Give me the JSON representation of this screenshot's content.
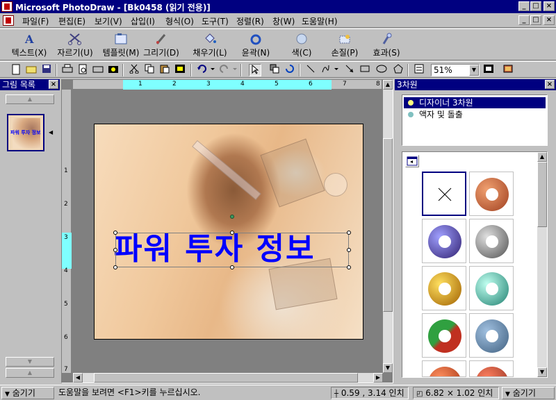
{
  "window": {
    "title": "Microsoft PhotoDraw - [Bk0458 (읽기 전용)]",
    "caption_buttons": [
      "_",
      "□",
      "×"
    ]
  },
  "menu": {
    "items": [
      "파일(F)",
      "편집(E)",
      "보기(V)",
      "삽입(I)",
      "형식(O)",
      "도구(T)",
      "정렬(R)",
      "창(W)",
      "도움말(H)"
    ],
    "doc_buttons": [
      "_",
      "□",
      "×"
    ]
  },
  "big_toolbar": {
    "buttons": [
      "텍스트(X)",
      "자르기(U)",
      "템플릿(M)",
      "그리기(D)",
      "채우기(L)",
      "윤곽(N)",
      "색(C)",
      "손질(P)",
      "효과(S)"
    ]
  },
  "small_toolbar": {
    "zoom": "51%"
  },
  "picture_list": {
    "title": "그림 목록",
    "thumb_text": "파워 투자 정보"
  },
  "canvas": {
    "slide_title": "파워 투자 정보",
    "ruler_h": [
      "1",
      "2",
      "3",
      "4",
      "5",
      "6",
      "7",
      "8"
    ],
    "ruler_v": [
      "1",
      "2",
      "3",
      "4",
      "5",
      "6",
      "7"
    ]
  },
  "three_d": {
    "title": "3차원",
    "types": [
      {
        "label": "디자이너 3차원",
        "selected": true,
        "dot_color": "#ffff80"
      },
      {
        "label": "액자 및 돌출",
        "selected": false,
        "dot_color": "#80c0c0"
      }
    ]
  },
  "status": {
    "hide_left": "숨기기",
    "help": "도움말을 보려면 <F1>키를 누르십시오.",
    "position": "0.59 , 3.14 인치",
    "size": "6.82 × 1.02 인치",
    "hide_right": "숨기기"
  },
  "colors": {
    "title_bar": "#000080",
    "slide_text": "#0000ff",
    "ruler_highlight": "#7fffff"
  }
}
